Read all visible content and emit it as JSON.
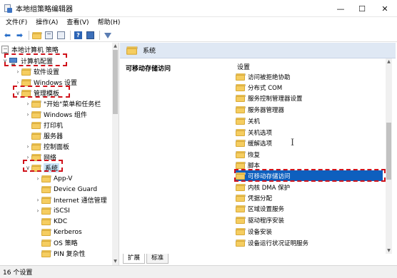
{
  "window": {
    "title": "本地组策略编辑器",
    "controls": {
      "minimize": "—",
      "maximize": "☐",
      "close": "✕"
    }
  },
  "menu": [
    "文件(F)",
    "操作(A)",
    "查看(V)",
    "帮助(H)"
  ],
  "toolbar": [
    "back-icon",
    "forward-icon",
    "up-folder-icon",
    "show-tree-icon",
    "export-icon",
    "help-icon",
    "properties-icon",
    "filter-icon"
  ],
  "tree": {
    "items": [
      {
        "label": "本地计算机 策略",
        "icon": "computer-policy-icon",
        "twisty": ""
      },
      {
        "label": "计算机配置",
        "icon": "computer-icon",
        "twisty": "∨"
      },
      {
        "label": "软件设置",
        "icon": "folder-icon",
        "twisty": "›"
      },
      {
        "label": "Windows 设置",
        "icon": "folder-icon",
        "twisty": "›"
      },
      {
        "label": "管理模板",
        "icon": "folder-icon",
        "twisty": "∨"
      },
      {
        "label": "\"开始\"菜单和任务栏",
        "icon": "folder-icon",
        "twisty": "›"
      },
      {
        "label": "Windows 组件",
        "icon": "folder-icon",
        "twisty": "›"
      },
      {
        "label": "打印机",
        "icon": "folder-icon",
        "twisty": ""
      },
      {
        "label": "服务器",
        "icon": "folder-icon",
        "twisty": ""
      },
      {
        "label": "控制面板",
        "icon": "folder-icon",
        "twisty": "›"
      },
      {
        "label": "网络",
        "icon": "folder-icon",
        "twisty": "›"
      },
      {
        "label": "系统",
        "icon": "folder-icon",
        "twisty": "∨"
      },
      {
        "label": "App-V",
        "icon": "folder-icon",
        "twisty": "›"
      },
      {
        "label": "Device Guard",
        "icon": "folder-icon",
        "twisty": ""
      },
      {
        "label": "Internet 通信管理",
        "icon": "folder-icon",
        "twisty": "›"
      },
      {
        "label": "iSCSI",
        "icon": "folder-icon",
        "twisty": "›"
      },
      {
        "label": "KDC",
        "icon": "folder-icon",
        "twisty": ""
      },
      {
        "label": "Kerberos",
        "icon": "folder-icon",
        "twisty": ""
      },
      {
        "label": "OS 策略",
        "icon": "folder-icon",
        "twisty": ""
      },
      {
        "label": "PIN 复杂性",
        "icon": "folder-icon",
        "twisty": ""
      }
    ]
  },
  "right": {
    "header": "系统",
    "description_title": "可移动存储访问",
    "settings_header": "设置",
    "settings": [
      "访问被拒绝协助",
      "分布式 COM",
      "服务控制管理器设置",
      "服务器管理器",
      "关机",
      "关机选项",
      "缓解选项",
      "恢复",
      "脚本",
      "可移动存储访问",
      "内核 DMA 保护",
      "凭据分配",
      "区域设置服务",
      "驱动程序安装",
      "设备安装",
      "设备运行状况证明服务"
    ],
    "selected_index": 9
  },
  "tabs": [
    "扩展",
    "标准"
  ],
  "status": "16 个设置",
  "colors": {
    "highlight_box": "#d0121b",
    "selection": "#0e5fbe",
    "header_bg": "#dfe8f4"
  }
}
